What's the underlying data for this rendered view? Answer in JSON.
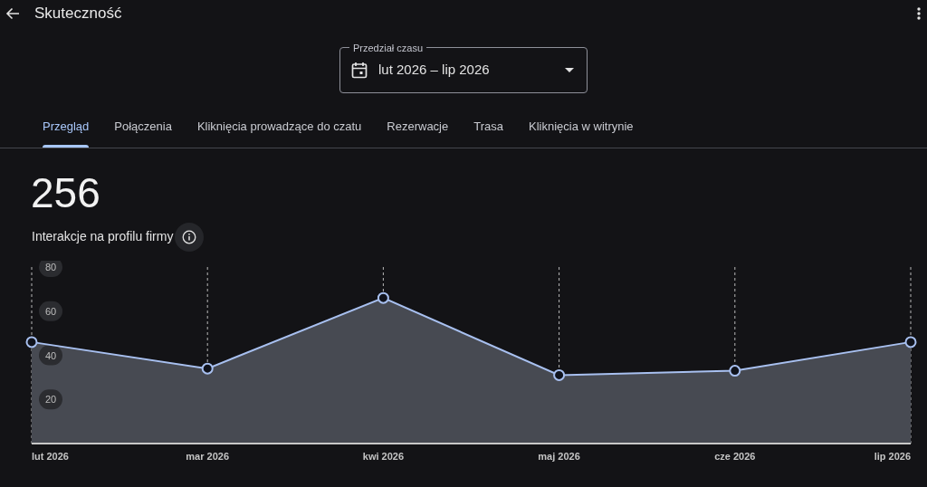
{
  "header": {
    "title": "Skuteczność"
  },
  "date_range": {
    "label": "Przedział czasu",
    "value": "lut 2026 – lip 2026"
  },
  "tabs": [
    {
      "label": "Przegląd",
      "selected": true
    },
    {
      "label": "Połączenia",
      "selected": false
    },
    {
      "label": "Kliknięcia prowadzące do czatu",
      "selected": false
    },
    {
      "label": "Rezerwacje",
      "selected": false
    },
    {
      "label": "Trasa",
      "selected": false
    },
    {
      "label": "Kliknięcia w witrynie",
      "selected": false
    }
  ],
  "summary": {
    "total": "256",
    "label": "Interakcje na profilu firmy"
  },
  "chart": {
    "chart_data": {
      "type": "area",
      "categories": [
        "lut 2026",
        "mar 2026",
        "kwi 2026",
        "maj 2026",
        "cze 2026",
        "lip 2026"
      ],
      "series": [
        {
          "color": "#a8c0f0",
          "values": [
            46,
            34,
            66,
            31,
            33,
            46
          ]
        }
      ],
      "grid": true,
      "ylim": [
        0,
        80
      ],
      "yticks": [
        20,
        40,
        60,
        80
      ]
    }
  }
}
